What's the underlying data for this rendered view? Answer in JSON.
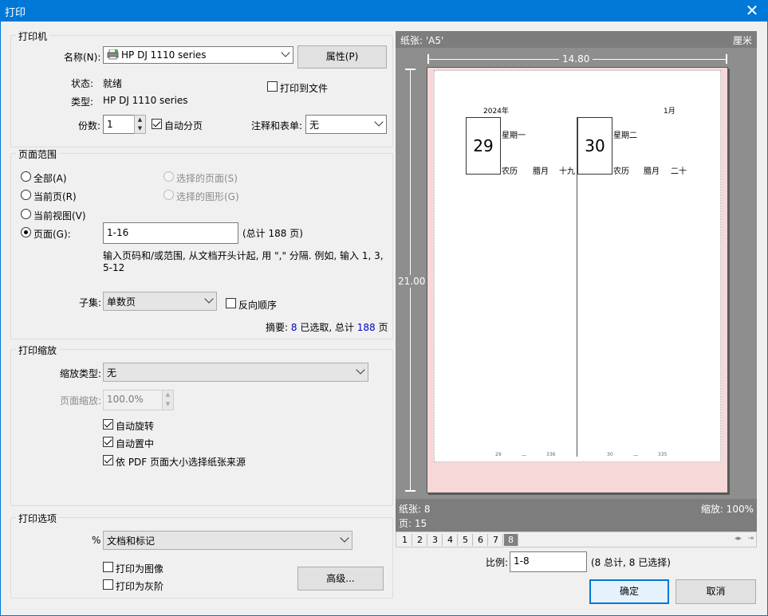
{
  "window": {
    "title": "打印",
    "close_glyph": "✕"
  },
  "printer": {
    "group": "打印机",
    "name_label": "名称(N):",
    "name_value": "HP DJ 1110 series",
    "properties_btn": "属性(P)",
    "status_label": "状态:",
    "status_value": "就绪",
    "type_label": "类型:",
    "type_value": "HP DJ 1110 series",
    "print_to_file": "打印到文件",
    "copies_label": "份数:",
    "copies_value": "1",
    "collate": "自动分页",
    "comments_label": "注释和表单:",
    "comments_value": "无"
  },
  "range": {
    "group": "页面范围",
    "all": "全部(A)",
    "current": "当前页(R)",
    "current_view": "当前视图(V)",
    "pages": "页面(G):",
    "selected_pages": "选择的页面(S)",
    "selected_graphics": "选择的图形(G)",
    "pages_value": "1-16",
    "total": "(总计 188 页)",
    "hint_line1": "输入页码和/或范围, 从文档开头计起, 用 \",\" 分隔. 例如, 输入 1, 3,",
    "hint_line2": "5-12",
    "subset_label": "子集:",
    "subset_value": "单数页",
    "reverse": "反向顺序",
    "summary_prefix": "摘要: ",
    "summary_selected": "8",
    "summary_mid": " 已选取, 总计 ",
    "summary_total": "188",
    "summary_suffix": " 页"
  },
  "scaling": {
    "group": "打印缩放",
    "type_label": "缩放类型:",
    "type_value": "无",
    "zoom_label": "页面缩放:",
    "zoom_value": "100.0%",
    "auto_rotate": "自动旋转",
    "auto_center": "自动置中",
    "pdf_source": "依 PDF 页面大小选择纸张来源"
  },
  "options": {
    "group": "打印选项",
    "what_label": "%",
    "what_value": "文档和标记",
    "as_image": "打印为图像",
    "grayscale": "打印为灰阶",
    "advanced_btn": "高级..."
  },
  "preview": {
    "paper_label": "纸张: 'A5'",
    "unit": "厘米",
    "width": "14.80",
    "height": "21.00",
    "sheet_label": "纸张: 8",
    "page_label": "页: 15",
    "zoom_label": "缩放: 100%",
    "page_tabs": [
      "1",
      "2",
      "3",
      "4",
      "5",
      "6",
      "7",
      "8"
    ],
    "current_tab": "8",
    "calendar": {
      "year": "2024年",
      "month": "1月",
      "day1": "29",
      "day2": "30",
      "weekday1": "星期一",
      "weekday2": "星期二",
      "lunar1": "农历",
      "lunar_month1": "腊月",
      "lunar_day1": "十九",
      "lunar2": "农历",
      "lunar_month2": "腊月",
      "lunar_day2": "二十",
      "foot1_a": "29",
      "foot1_b": "一",
      "foot1_c": "336",
      "foot2_a": "30",
      "foot2_b": "一",
      "foot2_c": "335"
    }
  },
  "footer": {
    "ratio_label": "比例:",
    "ratio_value": "1-8",
    "ratio_info": "(8 总计, 8 已选择)",
    "ok": "确定",
    "cancel": "取消"
  }
}
